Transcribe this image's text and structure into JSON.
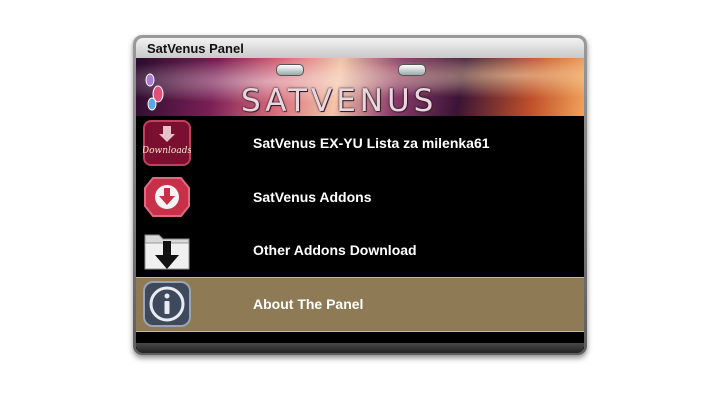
{
  "window": {
    "title": "SatVenus Panel"
  },
  "banner": {
    "logo_text": "SATVENUS"
  },
  "menu": {
    "items": [
      {
        "label": "SatVenus EX-YU Lista za milenka61",
        "icon": "downloads-icon",
        "icon_text": "Downloads",
        "selected": false
      },
      {
        "label": "SatVenus Addons",
        "icon": "download-badge-icon",
        "selected": false
      },
      {
        "label": "Other Addons Download",
        "icon": "folder-download-icon",
        "selected": false
      },
      {
        "label": "About The Panel",
        "icon": "info-icon",
        "selected": true
      }
    ]
  },
  "colors": {
    "selected_row": "#8e7b56",
    "menu_background": "#000000",
    "title_bar": "#dcdcdc"
  }
}
